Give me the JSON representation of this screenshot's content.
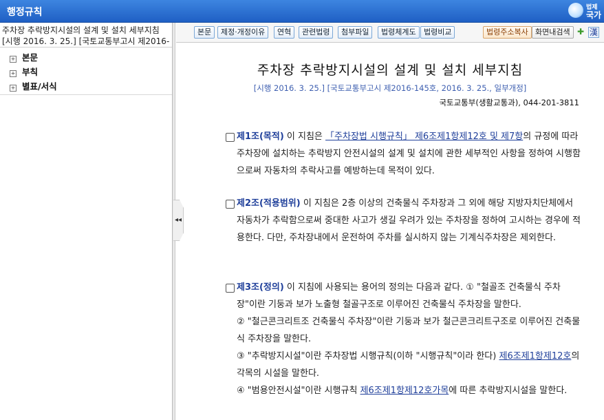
{
  "header": {
    "title": "행정규칙",
    "logo_line1": "법제",
    "logo_line2": "국가"
  },
  "sidebar": {
    "doc_title": "주차장 추락방지시설의 설계 및 설치 세부지침",
    "doc_meta": "[시행 2016. 3. 25.] [국토교통부고시 제2016-",
    "items": [
      {
        "label": "본문"
      },
      {
        "label": "부칙"
      },
      {
        "label": "별표/서식"
      }
    ]
  },
  "toolbar": {
    "buttons": [
      "본문",
      "제정·개정이유",
      "연혁",
      "관련법령",
      "첨부파일",
      "법령체계도",
      "법령비교"
    ],
    "copy_address": "법령주소복사",
    "search_in_page": "화면내검색",
    "hanja": "漢"
  },
  "document": {
    "title": "주차장 추락방지시설의 설계 및 설치 세부지침",
    "subtitle": "[시행 2016. 3. 25.] [국토교통부고시 제2016-145호, 2016. 3. 25., 일부개정]",
    "org": "국토교통부(생활교통과), 044-201-3811",
    "articles": [
      {
        "num": "제1조(목적)",
        "pre": " 이 지침은 ",
        "link1": "「주차장법 시행규칙」 제6조제1항제12호 및 제7항",
        "post": "의 규정에 따라 주차장에 설치하는 추락방지 안전시설의 설계 및 설치에 관한 세부적인 사항을 정하여 시행함으로써 자동차의 추락사고를 예방하는데 목적이 있다."
      },
      {
        "num": "제2조(적용범위)",
        "text": " 이 지침은 2층 이상의 건축물식 주차장과 그 외에 해당 지방자치단체에서 자동차가 추락함으로써 중대한 사고가 생길 우려가 있는 주차장을 정하여 고시하는 경우에 적용한다. 다만, 주차장내에서 운전하여 주차를 실시하지 않는 기계식주차장은 제외한다."
      },
      {
        "num": "제3조(정의)",
        "text": " 이 지침에 사용되는 용어의 정의는 다음과 같다. ① \"철골조 건축물식 주차장\"이란 기둥과 보가 노출형 철골구조로 이루어진 건축물식 주차장을 말한다.",
        "item2": "② \"철근콘크리트조 건축물식 주차장\"이란 기둥과 보가 철근콘크리트구조로 이루어진 건축물식 주차장을 말한다.",
        "item3_pre": "③ \"추락방지시설\"이란 주차장법 시행규칙(이하 \"시행규칙\"이라 한다) ",
        "item3_link": "제6조제1항제12호",
        "item3_post": "의 각목의 시설을 말한다.",
        "item4_pre": "④ \"범용안전시설\"이란 시행규칙 ",
        "item4_link": "제6조제1항제12호가목",
        "item4_post": "에 따른 추락방지시설을 말한다."
      }
    ]
  }
}
